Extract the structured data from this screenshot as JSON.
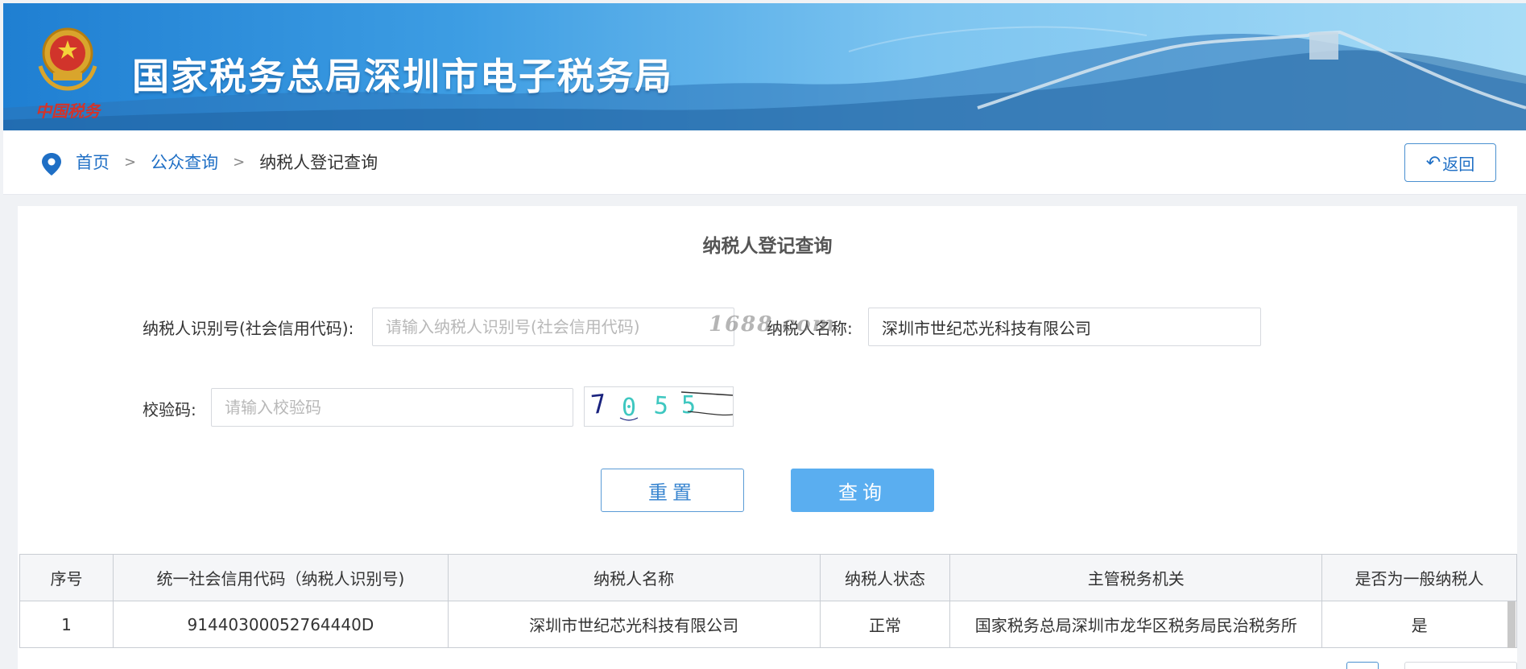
{
  "header": {
    "title": "国家税务总局深圳市电子税务局",
    "emblem_caption": "中国税务"
  },
  "breadcrumb": {
    "home": "首页",
    "sep": ">",
    "public_query": "公众查询",
    "current": "纳税人登记查询"
  },
  "back_button": {
    "icon": "↶",
    "label": "返回"
  },
  "form": {
    "title": "纳税人登记查询",
    "tax_id_label": "纳税人识别号(社会信用代码):",
    "tax_id_placeholder": "请输入纳税人识别号(社会信用代码)",
    "tax_id_value": "",
    "name_label": "纳税人名称:",
    "name_value": "深圳市世纪芯光科技有限公司",
    "code_label": "校验码:",
    "code_placeholder": "请输入校验码",
    "code_value": "",
    "captcha_text": "7055",
    "reset_label": "重置",
    "query_label": "查询"
  },
  "watermark": "1688.com",
  "table": {
    "headers": [
      "序号",
      "统一社会信用代码（纳税人识别号)",
      "纳税人名称",
      "纳税人状态",
      "主管税务机关",
      "是否为一般纳税人"
    ],
    "rows": [
      [
        "1",
        "91440300052764440D",
        "深圳市世纪芯光科技有限公司",
        "正常",
        "国家税务总局深圳市龙华区税务局民治税务所",
        "是"
      ]
    ]
  },
  "colors": {
    "primary": "#1f6fc5",
    "query_button": "#5aaef0",
    "banner_start": "#1f7fd2"
  }
}
